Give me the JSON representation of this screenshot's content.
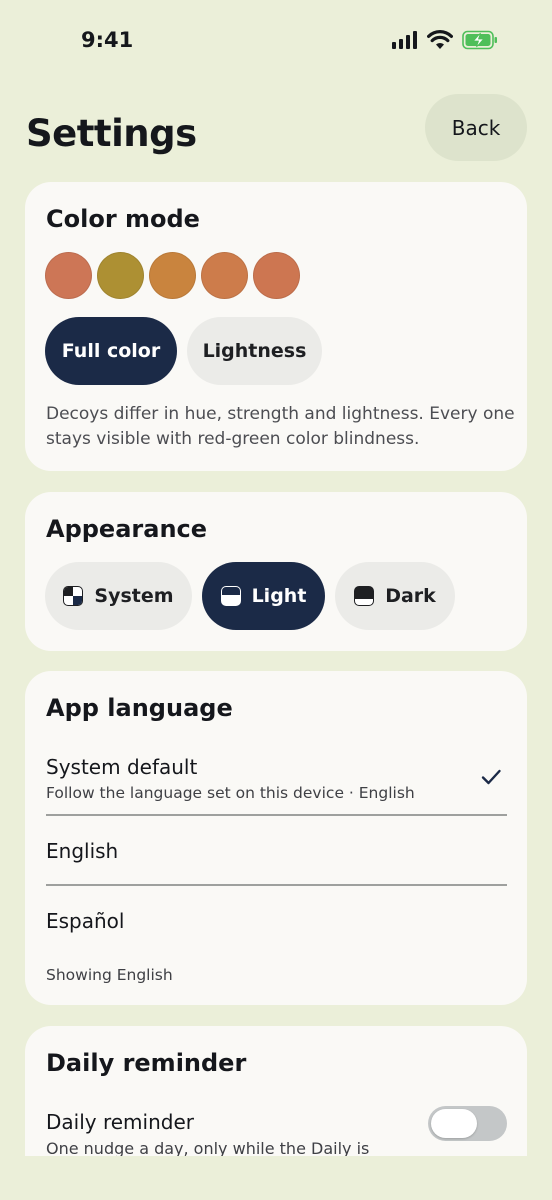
{
  "status_bar": {
    "time": "9:41"
  },
  "header": {
    "title": "Settings",
    "back_label": "Back"
  },
  "color_mode": {
    "title": "Color mode",
    "swatches": [
      "#cd7656",
      "#ad9033",
      "#c9843e",
      "#cd7c4b",
      "#cd7651"
    ],
    "options": [
      {
        "label": "Full color",
        "selected": true
      },
      {
        "label": "Lightness",
        "selected": false
      }
    ],
    "description": "Decoys differ in hue, strength and lightness. Every one stays visible with red-green color blindness."
  },
  "appearance": {
    "title": "Appearance",
    "options": [
      {
        "label": "System",
        "icon": "system-theme-icon",
        "selected": false
      },
      {
        "label": "Light",
        "icon": "light-theme-icon",
        "selected": true
      },
      {
        "label": "Dark",
        "icon": "dark-theme-icon",
        "selected": false
      }
    ]
  },
  "app_language": {
    "title": "App language",
    "options": [
      {
        "label": "System default",
        "sublabel": "Follow the language set on this device · English",
        "selected": true
      },
      {
        "label": "English",
        "selected": false
      },
      {
        "label": "Español",
        "selected": false
      }
    ],
    "footer": "Showing English"
  },
  "daily_reminder": {
    "title": "Daily reminder",
    "row_label": "Daily reminder",
    "row_sublabel": "One nudge a day, only while the Daily is",
    "enabled": false
  },
  "colors": {
    "accent": "#1b2a47",
    "background": "#ebefd9",
    "card": "#faf9f6"
  }
}
